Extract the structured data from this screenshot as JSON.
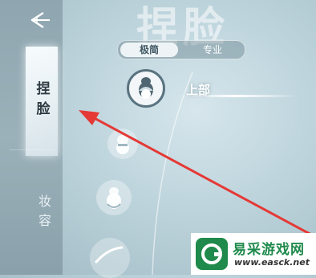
{
  "header": {
    "background_title": "捏脸"
  },
  "sidebar": {
    "back_icon": "back-arrow-icon",
    "tabs": [
      {
        "label": "捏脸",
        "active": true
      },
      {
        "label": "妆容",
        "active": false
      }
    ]
  },
  "mode_toggle": {
    "options": [
      "极简",
      "专业"
    ],
    "selected": "极简"
  },
  "parts": [
    {
      "label": "上部",
      "icon": "face-top-icon",
      "selected": true
    },
    {
      "label": "",
      "icon": "face-mid-icon",
      "selected": false
    },
    {
      "label": "",
      "icon": "face-low-icon",
      "selected": false
    },
    {
      "label": "",
      "icon": "eyebrow-icon",
      "selected": false
    }
  ],
  "annotation": {
    "color": "#e53935"
  },
  "watermark": {
    "name": "易采游戏网",
    "url": "www.easck.net",
    "color": "#1f8a4c"
  }
}
